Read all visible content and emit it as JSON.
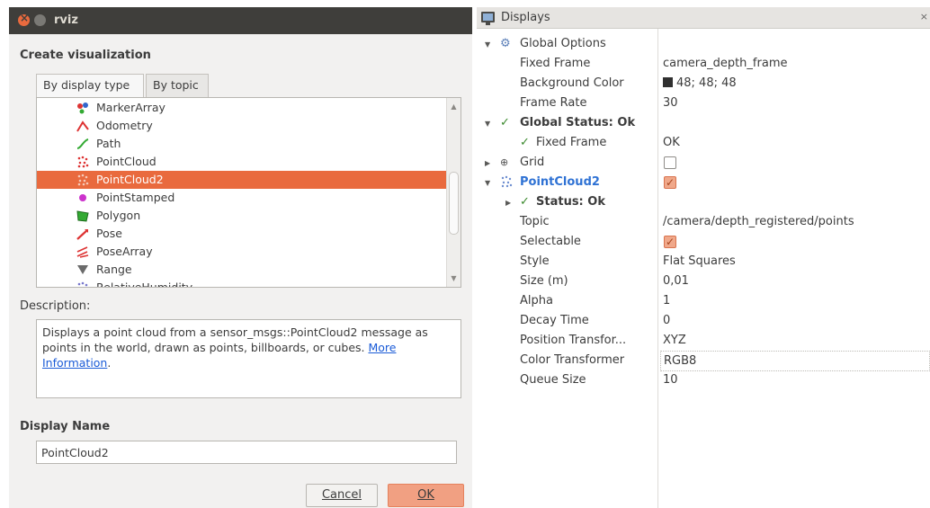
{
  "dialog": {
    "title": "rviz",
    "section_create": "Create visualization",
    "tabs": [
      {
        "label": "By display type",
        "active": true
      },
      {
        "label": "By topic",
        "active": false
      }
    ],
    "items": [
      {
        "label": "MarkerArray",
        "icon": "marker-array-icon"
      },
      {
        "label": "Odometry",
        "icon": "odometry-icon"
      },
      {
        "label": "Path",
        "icon": "path-icon"
      },
      {
        "label": "PointCloud",
        "icon": "point-cloud-icon"
      },
      {
        "label": "PointCloud2",
        "icon": "point-cloud2-icon",
        "selected": true
      },
      {
        "label": "PointStamped",
        "icon": "point-stamped-icon"
      },
      {
        "label": "Polygon",
        "icon": "polygon-icon"
      },
      {
        "label": "Pose",
        "icon": "pose-icon"
      },
      {
        "label": "PoseArray",
        "icon": "pose-array-icon"
      },
      {
        "label": "Range",
        "icon": "range-icon"
      },
      {
        "label": "RelativeHumidity",
        "icon": "relative-humidity-icon"
      }
    ],
    "description_label": "Description:",
    "description_text": "Displays a point cloud from a sensor_msgs::PointCloud2 message as points in the world, drawn as points, billboards, or cubes. ",
    "description_link": "More Information",
    "description_end": ".",
    "display_name_label": "Display Name",
    "display_name_value": "PointCloud2",
    "cancel_label": "Cancel",
    "ok_label": "OK"
  },
  "displays": {
    "title": "Displays",
    "close_glyph": "×",
    "global_options": "Global Options",
    "fixed_frame_label": "Fixed Frame",
    "fixed_frame_value": "camera_depth_frame",
    "background_color_label": "Background Color",
    "background_color_value": "48; 48; 48",
    "frame_rate_label": "Frame Rate",
    "frame_rate_value": "30",
    "global_status": "Global Status: Ok",
    "fixed_frame_status_label": "Fixed Frame",
    "fixed_frame_status_value": "OK",
    "grid_label": "Grid",
    "grid_enabled": false,
    "pointcloud2_label": "PointCloud2",
    "pointcloud2_enabled": true,
    "status_label": "Status: Ok",
    "topic_label": "Topic",
    "topic_value": "/camera/depth_registered/points",
    "selectable_label": "Selectable",
    "selectable_enabled": true,
    "style_label": "Style",
    "style_value": "Flat Squares",
    "size_label": "Size (m)",
    "size_value": "0,01",
    "alpha_label": "Alpha",
    "alpha_value": "1",
    "decay_label": "Decay Time",
    "decay_value": "0",
    "position_transformer_label": "Position Transfor...",
    "position_transformer_value": "XYZ",
    "color_transformer_label": "Color Transformer",
    "color_transformer_value": "RGB8",
    "queue_size_label": "Queue Size",
    "queue_size_value": "10"
  },
  "colors": {
    "accent": "#e96a3e",
    "titlebar": "#3f3e3b",
    "link": "#1a5bd7",
    "highlight_blue": "#2f72d4",
    "check_green": "#3b8a2e"
  }
}
